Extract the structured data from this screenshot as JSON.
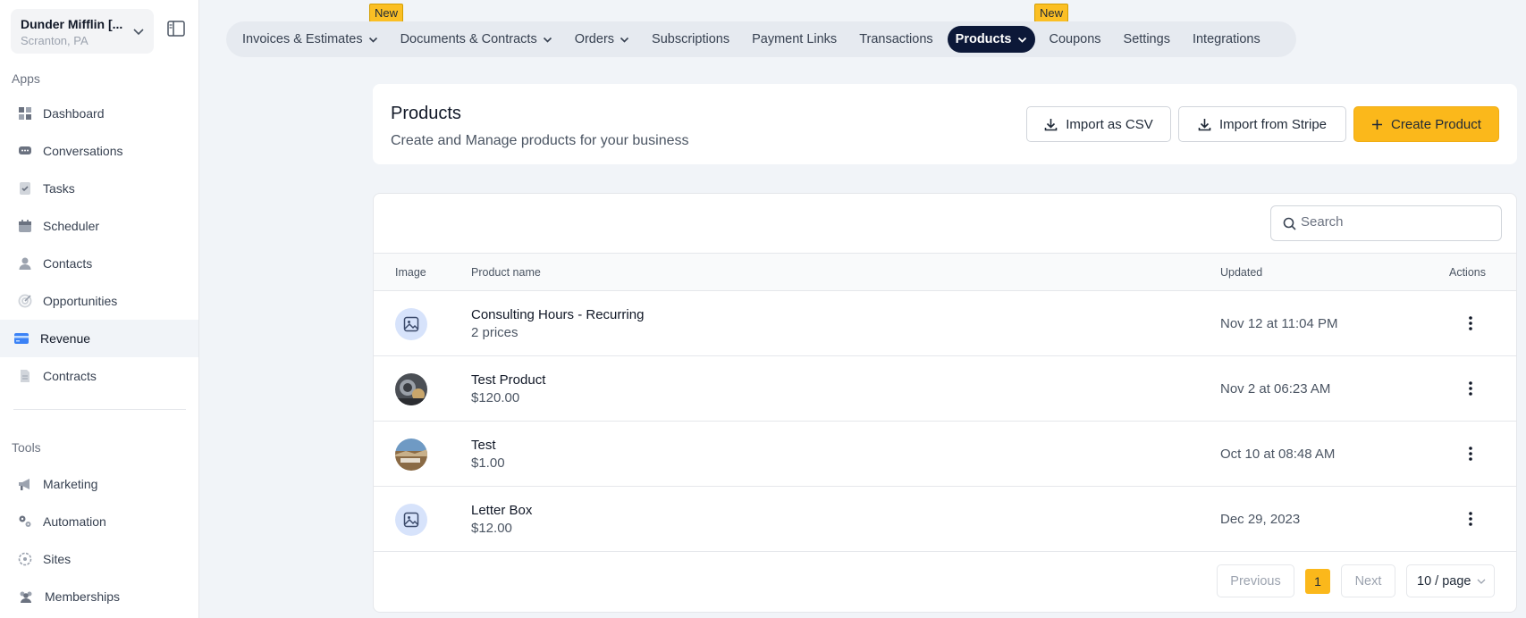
{
  "account": {
    "name": "Dunder Mifflin [...",
    "location": "Scranton, PA"
  },
  "sidebar": {
    "apps_label": "Apps",
    "apps": [
      {
        "label": "Dashboard",
        "icon": "dashboard-icon"
      },
      {
        "label": "Conversations",
        "icon": "chat-icon"
      },
      {
        "label": "Tasks",
        "icon": "task-icon"
      },
      {
        "label": "Scheduler",
        "icon": "calendar-icon"
      },
      {
        "label": "Contacts",
        "icon": "person-icon"
      },
      {
        "label": "Opportunities",
        "icon": "target-icon"
      },
      {
        "label": "Revenue",
        "icon": "credit-card-icon",
        "active": true
      },
      {
        "label": "Contracts",
        "icon": "document-icon"
      }
    ],
    "tools_label": "Tools",
    "tools": [
      {
        "label": "Marketing",
        "icon": "megaphone-icon"
      },
      {
        "label": "Automation",
        "icon": "gears-icon"
      },
      {
        "label": "Sites",
        "icon": "globe-icon"
      },
      {
        "label": "Memberships",
        "icon": "users-icon"
      }
    ]
  },
  "topnav": {
    "new_badge": "New",
    "tabs": [
      {
        "label": "Invoices & Estimates",
        "dropdown": true
      },
      {
        "label": "Documents & Contracts",
        "dropdown": true
      },
      {
        "label": "Orders",
        "dropdown": true
      },
      {
        "label": "Subscriptions"
      },
      {
        "label": "Payment Links"
      },
      {
        "label": "Transactions"
      },
      {
        "label": "Products",
        "dropdown": true,
        "active": true
      },
      {
        "label": "Coupons"
      },
      {
        "label": "Settings"
      },
      {
        "label": "Integrations"
      }
    ]
  },
  "header": {
    "title": "Products",
    "subtitle": "Create and Manage products for your business",
    "import_csv": "Import as CSV",
    "import_stripe": "Import from Stripe",
    "create": "Create Product"
  },
  "search": {
    "placeholder": "Search"
  },
  "table": {
    "columns": {
      "image": "Image",
      "name": "Product name",
      "updated": "Updated",
      "actions": "Actions"
    },
    "rows": [
      {
        "name": "Consulting Hours - Recurring",
        "price": "2 prices",
        "updated": "Nov 12 at 11:04 PM",
        "image": "placeholder-image-icon"
      },
      {
        "name": "Test Product",
        "price": "$120.00",
        "updated": "Nov 2 at 06:23 AM",
        "image": "product-photo"
      },
      {
        "name": "Test",
        "price": "$1.00",
        "updated": "Oct 10 at 08:48 AM",
        "image": "product-photo"
      },
      {
        "name": "Letter Box",
        "price": "$12.00",
        "updated": "Dec 29, 2023",
        "image": "placeholder-image-icon"
      }
    ]
  },
  "pagination": {
    "previous": "Previous",
    "current": "1",
    "next": "Next",
    "per_page": "10 / page"
  },
  "colors": {
    "accent": "#fbb81b",
    "active_tab": "#0c1838",
    "active_sidebar": "#3b82f6"
  }
}
